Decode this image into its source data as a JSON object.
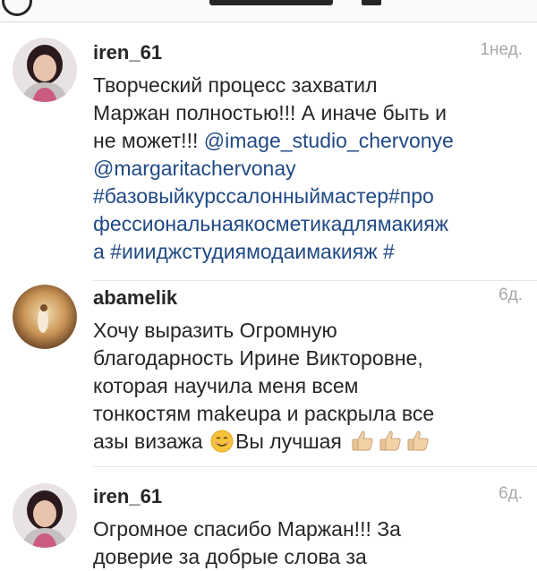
{
  "comments": [
    {
      "username": "iren_61",
      "time": "1нед.",
      "lines": [
        [
          {
            "t": "Творческий процесс захватил",
            "link": false
          }
        ],
        [
          {
            "t": "Маржан полностью!!! А иначе быть и",
            "link": false
          }
        ],
        [
          {
            "t": "не может!!! ",
            "link": false
          },
          {
            "t": "@image_studio_chervonye",
            "link": true
          }
        ],
        [
          {
            "t": "@margaritachervonay",
            "link": true
          }
        ],
        [
          {
            "t": "#базовыйкурссалонныймастер#про",
            "link": true
          }
        ],
        [
          {
            "t": "фессиональнаякосметикадлямакияж",
            "link": true
          }
        ],
        [
          {
            "t": "а #ииидж​студиямодаимакияж #",
            "link": true
          }
        ]
      ]
    },
    {
      "username": "abamelik",
      "time": "6д.",
      "lines": [
        "Хочу выразить Огромную",
        "благодарность Ирине Викторовне,",
        "которая научила меня всем",
        "тонкостям makeupa и раскрыла все"
      ],
      "last_line_before": "азы визажа",
      "last_line_after": "Вы лучшая",
      "emoji_icon": "smiling-face-icon",
      "thumbs_icon": "thumbs-up-icon",
      "thumbs_count": 3
    },
    {
      "username": "iren_61",
      "time": "6д.",
      "lines": [
        "Огромное спасибо Маржан!!! За",
        "доверие за добрые слова за"
      ]
    }
  ],
  "colors": {
    "text": "#262626",
    "link": "#1f4a86",
    "meta": "#a8a8a8",
    "divider": "#e6e6e6"
  }
}
